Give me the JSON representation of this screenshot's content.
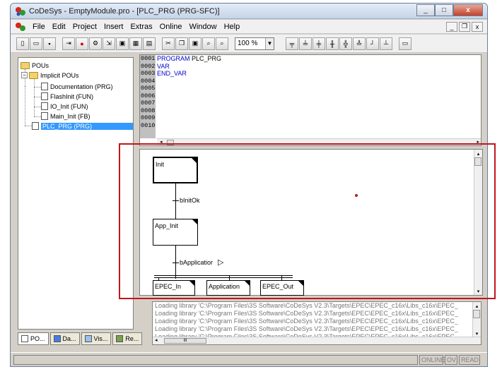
{
  "window": {
    "title": "CoDeSys - EmptyModule.pro - [PLC_PRG (PRG-SFC)]"
  },
  "window_buttons": {
    "minimize": "_",
    "maximize": "□",
    "close": "x"
  },
  "menu": [
    "File",
    "Edit",
    "Project",
    "Insert",
    "Extras",
    "Online",
    "Window",
    "Help"
  ],
  "mdi_buttons": {
    "minimize": "_",
    "restore": "❐",
    "close": "x"
  },
  "toolbar": {
    "zoom": "100 %"
  },
  "tree": {
    "root": "POUs",
    "folder": "Implicit POUs",
    "items": [
      "Documentation (PRG)",
      "FlashInit (FUN)",
      "IO_Init (FUN)",
      "Main_Init (FB)"
    ],
    "selected": "PLC_PRG (PRG)"
  },
  "left_tabs": [
    "PO...",
    "Da...",
    "Vis...",
    "Re..."
  ],
  "declaration": {
    "line_numbers": [
      "0001",
      "0002",
      "0003",
      "0004",
      "0005",
      "0006",
      "0007",
      "0008",
      "0009",
      "0010"
    ],
    "keyword1": "PROGRAM",
    "name": "PLC_PRG",
    "line2": "VAR",
    "line3": "END_VAR"
  },
  "sfc": {
    "steps": {
      "init": "Init",
      "app_init": "App_Init",
      "epec_in": "EPEC_In",
      "application": "Application",
      "epec_out": "EPEC_Out"
    },
    "transitions": {
      "t1": "bInitOk",
      "t2": "bApplicatior"
    }
  },
  "messages": [
    "Loading library 'C:\\Program Files\\3S Software\\CoDeSys V2.3\\Targets\\EPEC\\EPEC_c16x\\Libs_c16x\\EPEC_",
    "Loading library 'C:\\Program Files\\3S Software\\CoDeSys V2.3\\Targets\\EPEC\\EPEC_c16x\\Libs_c16x\\EPEC_",
    "Loading library 'C:\\Program Files\\3S Software\\CoDeSys V2.3\\Targets\\EPEC\\EPEC_c16x\\Libs_c16x\\EPEC_",
    "Loading library 'C:\\Program Files\\3S Software\\CoDeSys V2.3\\Targets\\EPEC\\EPEC_c16x\\Libs_c16x\\EPEC_",
    "Loading library 'C:\\Program Files\\3S Software\\CoDeSys V2.3\\Targets\\EPEC\\EPEC_c16x\\Libs_c16x\\EPEC_"
  ],
  "messages_thumb": "III",
  "status": {
    "online": "ONLINE",
    "ov": "OV",
    "read": "READ"
  },
  "colors": {
    "highlight": "#c0161c",
    "keyword": "#0000cc",
    "selection": "#3399ff"
  }
}
